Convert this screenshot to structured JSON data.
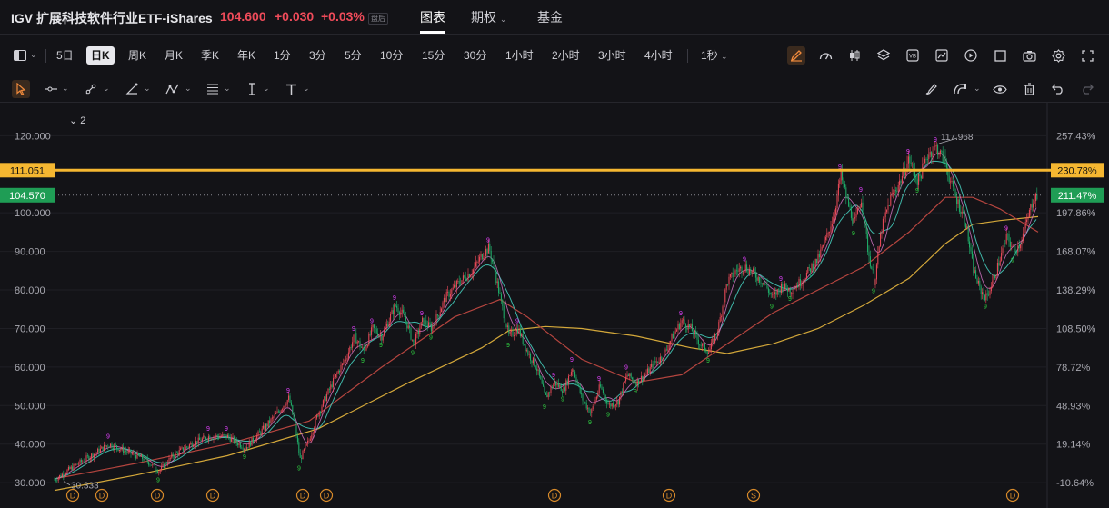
{
  "header": {
    "title": "IGV 扩展科技软件行业ETF-iShares",
    "price": "104.600",
    "change": "+0.030",
    "change_pct": "+0.03%",
    "tag": "盘后",
    "tabs": [
      "图表",
      "期权",
      "基金"
    ],
    "active_tab": "图表"
  },
  "periods": [
    "5日",
    "日K",
    "周K",
    "月K",
    "季K",
    "年K",
    "1分",
    "3分",
    "5分",
    "10分",
    "15分",
    "30分",
    "1小时",
    "2小时",
    "3小时",
    "4小时",
    "1秒"
  ],
  "active_period": "日K",
  "indicator_toggle": "2",
  "toolbar_icons": [
    "layout-icon",
    "pencil-icon",
    "speed-icon",
    "candles-icon",
    "layers-icon",
    "vb-icon",
    "compare-icon",
    "replay-icon",
    "square-icon",
    "camera-icon",
    "gear-icon",
    "fullscreen-icon"
  ],
  "draw_icons": [
    "cursor-icon",
    "line-tool-icon",
    "ray-tool-icon",
    "angle-tool-icon",
    "pattern-tool-icon",
    "fib-tool-icon",
    "text-cursor-icon",
    "text-tool-icon"
  ],
  "right_icons": [
    "brush-icon",
    "magnet-icon",
    "eye-icon",
    "trash-icon",
    "undo-icon",
    "redo-icon"
  ],
  "colors": {
    "up": "#f04b5a",
    "down": "#20b26c",
    "alert_line": "#f5b731",
    "current_price_bg": "#1f9d55",
    "ma_yellow": "#d4a83a",
    "ma_red": "#b5453f",
    "ma_teal": "#3fb6a8",
    "ma_pink": "#e07bd0",
    "seq_magenta": "#e040fb",
    "seq_green": "#2ecc40"
  },
  "chart_data": {
    "type": "line",
    "y_ticks": [
      "120.000",
      "100.000",
      "90.000",
      "80.000",
      "70.000",
      "60.000",
      "50.000",
      "40.000",
      "30.000"
    ],
    "y_tick_values": [
      120,
      100,
      90,
      80,
      70,
      60,
      50,
      40,
      30
    ],
    "pct_ticks": [
      "257.43%",
      "197.86%",
      "168.07%",
      "138.29%",
      "108.50%",
      "78.72%",
      "48.93%",
      "19.14%",
      "-10.64%"
    ],
    "ylim": [
      26.5,
      125.5
    ],
    "alert_price": "111.051",
    "alert_value": 111.051,
    "alert_pct": "230.78%",
    "current_price": "104.570",
    "current_value": 104.57,
    "current_pct": "211.47%",
    "max_label": "117.968",
    "max_value": 117.968,
    "max_x": 1033,
    "min_label": "30.333",
    "min_value": 30.333,
    "min_x": 70,
    "dividend_marker_x": [
      80,
      112,
      173,
      234,
      333,
      359,
      610,
      736,
      1114
    ],
    "dividend_labels": [
      "D",
      "D",
      "D",
      "D",
      "D",
      "D",
      "D",
      "D",
      "D"
    ],
    "split_marker_x": [
      829
    ],
    "split_labels": [
      "S"
    ],
    "price_path": [
      [
        60,
        30.8
      ],
      [
        80,
        34
      ],
      [
        100,
        37
      ],
      [
        120,
        40
      ],
      [
        140,
        38
      ],
      [
        160,
        36
      ],
      [
        175,
        33
      ],
      [
        190,
        37
      ],
      [
        210,
        40
      ],
      [
        230,
        42
      ],
      [
        250,
        42
      ],
      [
        270,
        39
      ],
      [
        290,
        44
      ],
      [
        305,
        48
      ],
      [
        318,
        52
      ],
      [
        325,
        44
      ],
      [
        330,
        36
      ],
      [
        340,
        41
      ],
      [
        350,
        48
      ],
      [
        360,
        53
      ],
      [
        370,
        58
      ],
      [
        380,
        62
      ],
      [
        390,
        68
      ],
      [
        400,
        64
      ],
      [
        410,
        70
      ],
      [
        420,
        68
      ],
      [
        435,
        76
      ],
      [
        445,
        73
      ],
      [
        455,
        66
      ],
      [
        465,
        72
      ],
      [
        475,
        70
      ],
      [
        490,
        78
      ],
      [
        505,
        82
      ],
      [
        520,
        85
      ],
      [
        530,
        89
      ],
      [
        538,
        91
      ],
      [
        545,
        84
      ],
      [
        552,
        76
      ],
      [
        560,
        68
      ],
      [
        570,
        70
      ],
      [
        580,
        64
      ],
      [
        590,
        60
      ],
      [
        600,
        52
      ],
      [
        610,
        56
      ],
      [
        620,
        54
      ],
      [
        630,
        60
      ],
      [
        640,
        52
      ],
      [
        650,
        48
      ],
      [
        660,
        55
      ],
      [
        670,
        50
      ],
      [
        680,
        51
      ],
      [
        690,
        58
      ],
      [
        700,
        56
      ],
      [
        710,
        58
      ],
      [
        720,
        61
      ],
      [
        730,
        63
      ],
      [
        740,
        68
      ],
      [
        750,
        72
      ],
      [
        760,
        70
      ],
      [
        770,
        66
      ],
      [
        780,
        64
      ],
      [
        790,
        70
      ],
      [
        800,
        82
      ],
      [
        810,
        85
      ],
      [
        820,
        86
      ],
      [
        830,
        84
      ],
      [
        840,
        82
      ],
      [
        850,
        78
      ],
      [
        860,
        81
      ],
      [
        870,
        80
      ],
      [
        880,
        82
      ],
      [
        890,
        85
      ],
      [
        900,
        88
      ],
      [
        910,
        94
      ],
      [
        918,
        100
      ],
      [
        925,
        110
      ],
      [
        932,
        103
      ],
      [
        940,
        97
      ],
      [
        948,
        104
      ],
      [
        955,
        90
      ],
      [
        962,
        82
      ],
      [
        970,
        96
      ],
      [
        980,
        104
      ],
      [
        990,
        108
      ],
      [
        1000,
        114
      ],
      [
        1010,
        108
      ],
      [
        1020,
        115
      ],
      [
        1030,
        117
      ],
      [
        1040,
        113
      ],
      [
        1048,
        106
      ],
      [
        1055,
        102
      ],
      [
        1062,
        98
      ],
      [
        1070,
        86
      ],
      [
        1078,
        80
      ],
      [
        1085,
        78
      ],
      [
        1092,
        82
      ],
      [
        1100,
        88
      ],
      [
        1108,
        94
      ],
      [
        1115,
        90
      ],
      [
        1122,
        92
      ],
      [
        1130,
        98
      ],
      [
        1137,
        104
      ],
      [
        1142,
        104.6
      ]
    ],
    "ma_yellow_path": [
      [
        60,
        28
      ],
      [
        150,
        32
      ],
      [
        250,
        37
      ],
      [
        350,
        44
      ],
      [
        450,
        56
      ],
      [
        530,
        65
      ],
      [
        560,
        69.5
      ],
      [
        600,
        70.5
      ],
      [
        640,
        70
      ],
      [
        700,
        68
      ],
      [
        760,
        65
      ],
      [
        800,
        63.5
      ],
      [
        850,
        66
      ],
      [
        900,
        70
      ],
      [
        950,
        76
      ],
      [
        1000,
        83
      ],
      [
        1040,
        92
      ],
      [
        1070,
        97
      ],
      [
        1100,
        98
      ],
      [
        1142,
        99
      ]
    ],
    "ma_red_path": [
      [
        60,
        31
      ],
      [
        150,
        35
      ],
      [
        250,
        40
      ],
      [
        340,
        46
      ],
      [
        420,
        60
      ],
      [
        500,
        73
      ],
      [
        550,
        77.5
      ],
      [
        580,
        73
      ],
      [
        640,
        62
      ],
      [
        700,
        56
      ],
      [
        750,
        58
      ],
      [
        800,
        66
      ],
      [
        850,
        74
      ],
      [
        900,
        80
      ],
      [
        950,
        86
      ],
      [
        1000,
        95
      ],
      [
        1040,
        104
      ],
      [
        1070,
        104
      ],
      [
        1100,
        101
      ],
      [
        1142,
        95
      ]
    ]
  }
}
